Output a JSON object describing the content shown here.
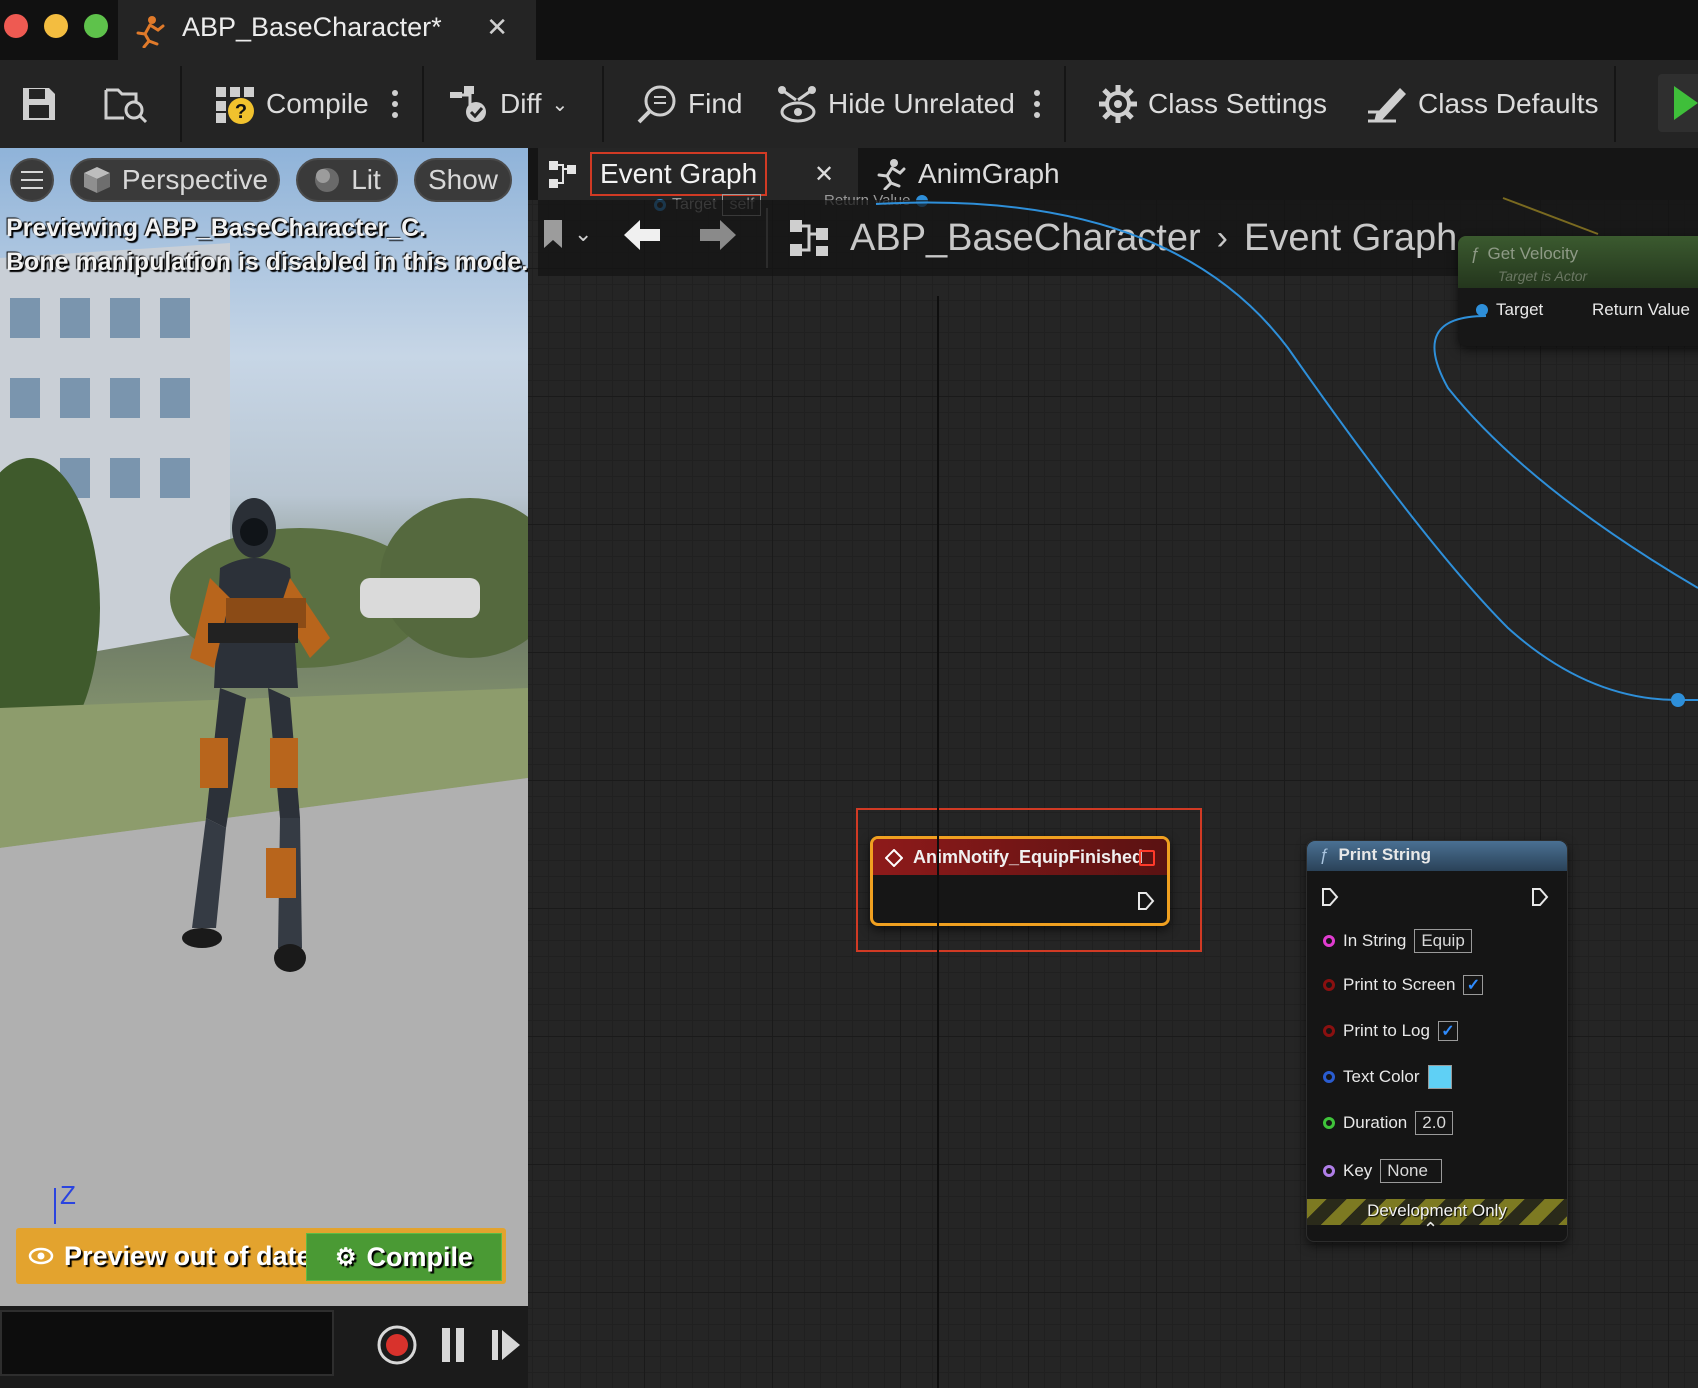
{
  "window": {
    "tab_title": "ABP_BaseCharacter*",
    "tab_close": "✕"
  },
  "toolbar": {
    "compile": "Compile",
    "diff": "Diff",
    "find": "Find",
    "hide_unrelated": "Hide Unrelated",
    "class_settings": "Class Settings",
    "class_defaults": "Class Defaults"
  },
  "viewport": {
    "perspective": "Perspective",
    "lit": "Lit",
    "show": "Show",
    "message_line1": "Previewing ABP_BaseCharacter_C.",
    "message_line2": "Bone manipulation is disabled in this mode.",
    "axis_label": "Z",
    "preview_out_of_date": "Preview out of date",
    "compile_button": "Compile"
  },
  "graph_tabs": {
    "event_graph": "Event Graph",
    "close": "✕",
    "anim_graph": "AnimGraph"
  },
  "breadcrumb": {
    "root": "ABP_BaseCharacter",
    "current": "Event Graph"
  },
  "ghost_node": {
    "target_label": "Target",
    "target_value": "self",
    "return_value": "Return Value"
  },
  "get_velocity": {
    "title": "Get Velocity",
    "subtitle": "Target is Actor",
    "target": "Target",
    "return_value": "Return Value"
  },
  "event_node": {
    "title": "AnimNotify_EquipFinished"
  },
  "print_string": {
    "title": "Print String",
    "in_string_label": "In String",
    "in_string_value": "Equip",
    "print_to_screen_label": "Print to Screen",
    "print_to_screen_checked": true,
    "print_to_log_label": "Print to Log",
    "print_to_log_checked": true,
    "text_color_label": "Text Color",
    "text_color_value": "#5fd0f5",
    "duration_label": "Duration",
    "duration_value": "2.0",
    "key_label": "Key",
    "key_value": "None",
    "development_only": "Development Only",
    "checkmark": "✓",
    "expand_icon": "⌃"
  },
  "colors": {
    "highlight_frame": "#d13a24",
    "node_selected": "#f0a020",
    "event_header": "#8e1a1a",
    "function_header": "#3b5d7e",
    "pure_header": "#3b5a2f",
    "wire_blue": "#2e8fd9"
  }
}
